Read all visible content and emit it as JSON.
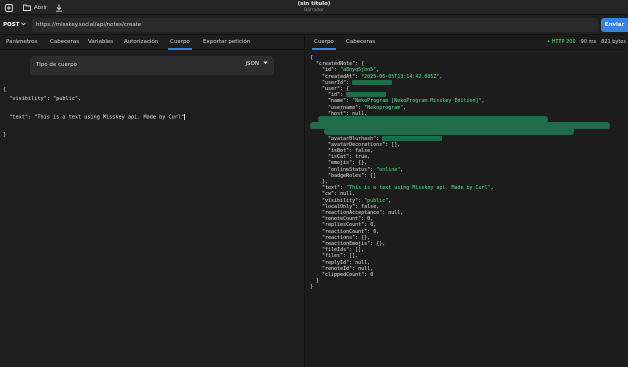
{
  "titlebar": {
    "new_icon": "new-tab-icon",
    "open_label": "Abrir",
    "title": "(sin título)",
    "subtitle": "Borrador",
    "save_icon": "download-icon"
  },
  "request": {
    "method": "POST",
    "url": "https://misskey.social/api/notes/create",
    "send_label": "Enviar"
  },
  "left_tabs": [
    "Parámetros",
    "Cabeceras",
    "Variables",
    "Autorización",
    "Cuerpo",
    "Exportar petición"
  ],
  "active_left_tab": "Cuerpo",
  "body_type": {
    "label": "Tipo de cuerpo",
    "value": "JSON"
  },
  "request_body": [
    "{",
    "  \"visibility\": \"public\",",
    "",
    "  \"text\": \"This is a text using Misskey api. Made by Curl\"",
    "",
    "}"
  ],
  "right_tabs": [
    "Cuerpo",
    "Cabeceras"
  ],
  "active_right_tab": "Cuerpo",
  "response_status": {
    "code": "• HTTP 200",
    "time": "90 ms",
    "size": "821 bytes"
  },
  "response_lines": [
    {
      "indent": 0,
      "text": "{"
    },
    {
      "indent": 1,
      "key": "\"createdNote\"",
      "punct": ": {"
    },
    {
      "indent": 2,
      "key": "\"id\"",
      "val": "\"a8nyq5jbo5\"",
      "tail": ","
    },
    {
      "indent": 2,
      "key": "\"createdAt\"",
      "val": "\"2025-06-05T13:14:42.085Z\"",
      "tail": ","
    },
    {
      "indent": 2,
      "key": "\"userId\"",
      "redact": 40,
      "tail": ""
    },
    {
      "indent": 2,
      "key": "\"user\"",
      "punct": ": {"
    },
    {
      "indent": 3,
      "key": "\"id\"",
      "redact": 40,
      "tail": ""
    },
    {
      "indent": 3,
      "key": "\"name\"",
      "val": "\"NekoProgram [NekoProgram Misskey Edition]\"",
      "tail": ","
    },
    {
      "indent": 3,
      "key": "\"username\"",
      "val": "\"Nekoprogram\"",
      "tail": ","
    },
    {
      "indent": 3,
      "key": "\"host\"",
      "num": "null",
      "tail": ","
    },
    {
      "indent": 3,
      "key": "",
      "text": ""
    },
    {
      "indent": 3,
      "key": "",
      "text": ""
    },
    {
      "indent": 3,
      "key": "",
      "text": ""
    },
    {
      "indent": 3,
      "key": "\"avatarBlurhash\"",
      "redact": 60,
      "tail": ""
    },
    {
      "indent": 3,
      "key": "\"avatarDecorations\"",
      "num": "[]",
      "tail": ","
    },
    {
      "indent": 3,
      "key": "\"isBot\"",
      "num": "false",
      "tail": ","
    },
    {
      "indent": 3,
      "key": "\"isCat\"",
      "num": "true",
      "tail": ","
    },
    {
      "indent": 3,
      "key": "\"emojis\"",
      "num": "{}",
      "tail": ","
    },
    {
      "indent": 3,
      "key": "\"onlineStatus\"",
      "val": "\"online\"",
      "tail": ","
    },
    {
      "indent": 3,
      "key": "\"badgeRoles\"",
      "num": "[]",
      "tail": ""
    },
    {
      "indent": 2,
      "text": "},"
    },
    {
      "indent": 2,
      "key": "\"text\"",
      "val": "\"This is a text using Misskey api. Made by Curl\"",
      "tail": ","
    },
    {
      "indent": 2,
      "key": "\"cw\"",
      "num": "null",
      "tail": ","
    },
    {
      "indent": 2,
      "key": "\"visibility\"",
      "val": "\"public\"",
      "tail": ","
    },
    {
      "indent": 2,
      "key": "\"localOnly\"",
      "num": "false",
      "tail": ","
    },
    {
      "indent": 2,
      "key": "\"reactionAcceptance\"",
      "num": "null",
      "tail": ","
    },
    {
      "indent": 2,
      "key": "\"renoteCount\"",
      "num": "0",
      "tail": ","
    },
    {
      "indent": 2,
      "key": "\"repliesCount\"",
      "num": "0",
      "tail": ","
    },
    {
      "indent": 2,
      "key": "\"reactionCount\"",
      "num": "0",
      "tail": ","
    },
    {
      "indent": 2,
      "key": "\"reactions\"",
      "num": "{}",
      "tail": ","
    },
    {
      "indent": 2,
      "key": "\"reactionEmojis\"",
      "num": "{}",
      "tail": ","
    },
    {
      "indent": 2,
      "key": "\"fileIds\"",
      "num": "[]",
      "tail": ","
    },
    {
      "indent": 2,
      "key": "\"files\"",
      "num": "[]",
      "tail": ","
    },
    {
      "indent": 2,
      "key": "\"replyId\"",
      "num": "null",
      "tail": ","
    },
    {
      "indent": 2,
      "key": "\"renoteId\"",
      "num": "null",
      "tail": ","
    },
    {
      "indent": 2,
      "key": "\"clippedCount\"",
      "num": "0",
      "tail": ""
    },
    {
      "indent": 1,
      "text": "}"
    },
    {
      "indent": 0,
      "text": "}"
    }
  ],
  "colors": {
    "accent": "#3584e4",
    "string": "#57e389",
    "status_ok": "#57e389",
    "redaction": "#1f6b4a"
  }
}
